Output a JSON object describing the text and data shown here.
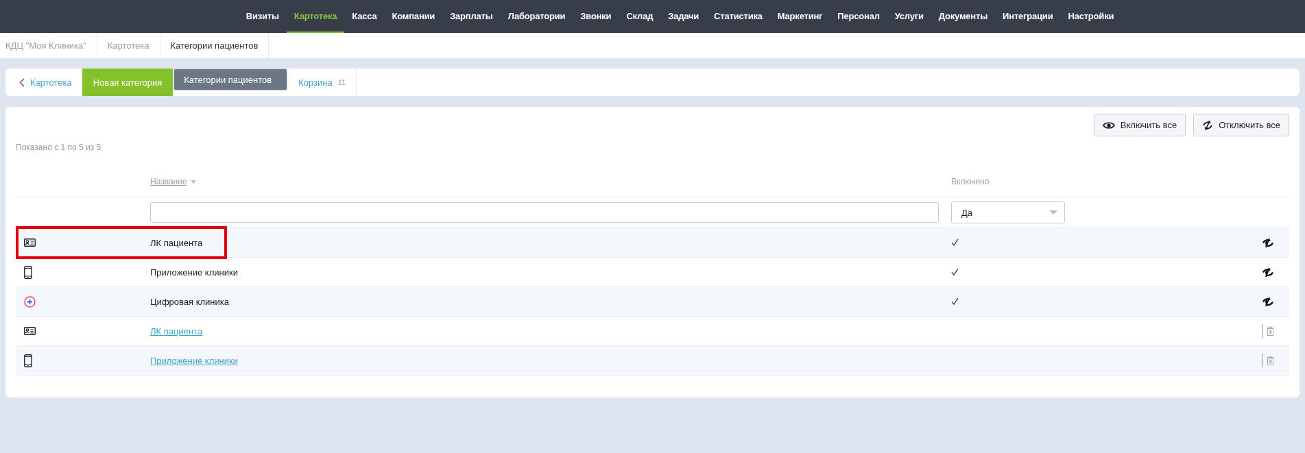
{
  "nav": [
    {
      "label": "Визиты",
      "selected": false
    },
    {
      "label": "Картотека",
      "selected": true
    },
    {
      "label": "Касса",
      "selected": false
    },
    {
      "label": "Компании",
      "selected": false
    },
    {
      "label": "Зарплаты",
      "selected": false
    },
    {
      "label": "Лаборатории",
      "selected": false
    },
    {
      "label": "Звонки",
      "selected": false
    },
    {
      "label": "Склад",
      "selected": false
    },
    {
      "label": "Задачи",
      "selected": false
    },
    {
      "label": "Статистика",
      "selected": false
    },
    {
      "label": "Маркетинг",
      "selected": false
    },
    {
      "label": "Персонал",
      "selected": false
    },
    {
      "label": "Услуги",
      "selected": false
    },
    {
      "label": "Документы",
      "selected": false
    },
    {
      "label": "Интеграции",
      "selected": false
    },
    {
      "label": "Настройки",
      "selected": false
    }
  ],
  "breadcrumbs": [
    {
      "label": "КДЦ \"Моя Клиника\"",
      "selected": false
    },
    {
      "label": "Картотека",
      "selected": false
    },
    {
      "label": "Категории пациентов",
      "selected": true
    }
  ],
  "toolbar": {
    "back": "Картотека",
    "new_button": "Новая категория",
    "tabs": [
      {
        "label": "Категории пациентов",
        "selected": true
      },
      {
        "label": "Корзина",
        "count": "11",
        "selected": false
      }
    ]
  },
  "actions": [
    "Включить все",
    "Отключить все"
  ],
  "summary": "Показано с 1 по 5 из 5",
  "table": {
    "columns": [
      "Название",
      "Включено"
    ],
    "filter_select": "Да",
    "rows": [
      {
        "kind": "card",
        "name": "ЛК пациента",
        "enabled": true,
        "highlighted": true
      },
      {
        "kind": "phone",
        "name": "Приложение клиники",
        "enabled": true,
        "highlighted": false
      },
      {
        "kind": "service",
        "name": "Цифровая клиника",
        "enabled": true,
        "highlighted": false
      },
      {
        "kind": "card",
        "name": "ЛК пациента",
        "enabled": false,
        "highlighted": false
      },
      {
        "kind": "phone",
        "name": "Приложение клиники",
        "enabled": false,
        "highlighted": false
      }
    ]
  }
}
